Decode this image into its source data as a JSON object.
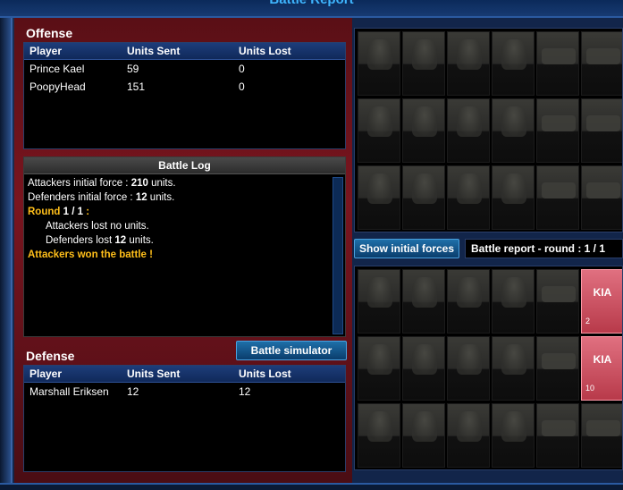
{
  "title": "Battle Report",
  "offense": {
    "heading": "Offense",
    "columns": [
      "Player",
      "Units Sent",
      "Units Lost"
    ],
    "rows": [
      [
        "Prince Kael",
        "59",
        "0"
      ],
      [
        "PoopyHead",
        "151",
        "0"
      ]
    ]
  },
  "battle_log": {
    "heading": "Battle Log",
    "lines": [
      {
        "text": "Attackers initial force : ",
        "bold": "210",
        "suffix": " units."
      },
      {
        "text": "Defenders initial force : ",
        "bold": "12",
        "suffix": " units."
      },
      {
        "round_label": "Round ",
        "round_value": "1 / 1",
        "round_suffix": " :"
      },
      {
        "indent": "Attackers lost no units."
      },
      {
        "indent_prefix": "Defenders lost ",
        "indent_bold": "12",
        "indent_suffix": " units."
      },
      {
        "result": "Attackers won the battle !"
      }
    ]
  },
  "defense": {
    "heading": "Defense",
    "columns": [
      "Player",
      "Units Sent",
      "Units Lost"
    ],
    "rows": [
      [
        "Marshall Eriksen",
        "12",
        "12"
      ]
    ]
  },
  "buttons": {
    "battle_simulator": "Battle simulator",
    "show_initial_forces": "Show initial forces"
  },
  "round_label": "Battle report - round : 1 / 1",
  "kia": [
    {
      "label": "KIA",
      "count": "2"
    },
    {
      "label": "KIA",
      "count": "10"
    }
  ]
}
